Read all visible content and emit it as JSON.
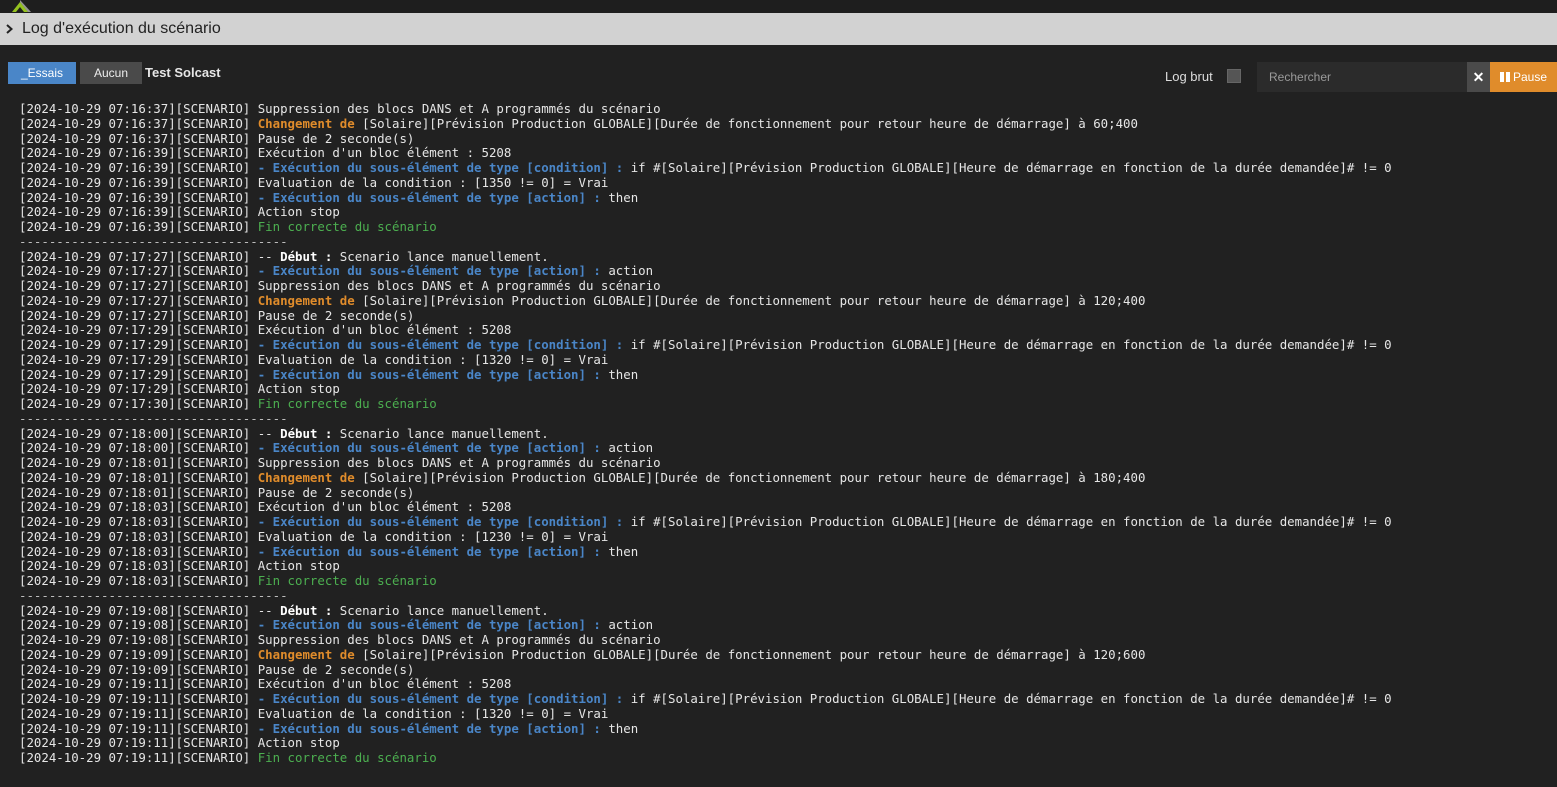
{
  "window": {
    "title": "Log d'exécution du scénario"
  },
  "toolbar": {
    "essais_label": "_Essais",
    "aucun_label": "Aucun",
    "scenario_name": "Test Solcast",
    "log_brut_label": "Log brut",
    "search_placeholder": "Rechercher",
    "clear_label": "✕",
    "pause_label": "Pause"
  },
  "colors": {
    "accent_blue": "#4a86c8",
    "accent_orange": "#e08c2b",
    "success_green": "#4caf50",
    "background": "#212121"
  },
  "log_lines": [
    {
      "type": "entry",
      "prefix": "[2024-10-29 07:16:37][SCENARIO] ",
      "parts": [
        {
          "s": "plain",
          "t": "Suppression des blocs DANS et A programmés du scénario"
        }
      ]
    },
    {
      "type": "entry",
      "prefix": "[2024-10-29 07:16:37][SCENARIO] ",
      "parts": [
        {
          "s": "orange",
          "t": "Changement de"
        },
        {
          "s": "plain",
          "t": " [Solaire][Prévision Production GLOBALE][Durée de fonctionnement pour retour heure de démarrage] à 60;400"
        }
      ]
    },
    {
      "type": "entry",
      "prefix": "[2024-10-29 07:16:37][SCENARIO] ",
      "parts": [
        {
          "s": "plain",
          "t": "Pause de 2 seconde(s)"
        }
      ]
    },
    {
      "type": "entry",
      "prefix": "[2024-10-29 07:16:39][SCENARIO] ",
      "parts": [
        {
          "s": "plain",
          "t": "Exécution d'un bloc élément : 5208"
        }
      ]
    },
    {
      "type": "entry",
      "prefix": "[2024-10-29 07:16:39][SCENARIO] ",
      "parts": [
        {
          "s": "blue",
          "t": "- Exécution du sous-élément de type [condition] :"
        },
        {
          "s": "plain",
          "t": " if #[Solaire][Prévision Production GLOBALE][Heure de démarrage en fonction de la durée demandée]# != 0"
        }
      ]
    },
    {
      "type": "entry",
      "prefix": "[2024-10-29 07:16:39][SCENARIO] ",
      "parts": [
        {
          "s": "plain",
          "t": "Evaluation de la condition : [1350 != 0] = Vrai"
        }
      ]
    },
    {
      "type": "entry",
      "prefix": "[2024-10-29 07:16:39][SCENARIO] ",
      "parts": [
        {
          "s": "blue",
          "t": "- Exécution du sous-élément de type [action] :"
        },
        {
          "s": "plain",
          "t": " then"
        }
      ]
    },
    {
      "type": "entry",
      "prefix": "[2024-10-29 07:16:39][SCENARIO] ",
      "parts": [
        {
          "s": "plain",
          "t": "Action stop"
        }
      ]
    },
    {
      "type": "entry",
      "prefix": "[2024-10-29 07:16:39][SCENARIO] ",
      "parts": [
        {
          "s": "green",
          "t": "Fin correcte du scénario"
        }
      ]
    },
    {
      "type": "separator",
      "text": "------------------------------------"
    },
    {
      "type": "entry",
      "prefix": "[2024-10-29 07:17:27][SCENARIO] ",
      "parts": [
        {
          "s": "plain",
          "t": "-- "
        },
        {
          "s": "bold",
          "t": "Début :"
        },
        {
          "s": "plain",
          "t": " Scenario lance manuellement."
        }
      ]
    },
    {
      "type": "entry",
      "prefix": "[2024-10-29 07:17:27][SCENARIO] ",
      "parts": [
        {
          "s": "blue",
          "t": "- Exécution du sous-élément de type [action] :"
        },
        {
          "s": "plain",
          "t": " action"
        }
      ]
    },
    {
      "type": "entry",
      "prefix": "[2024-10-29 07:17:27][SCENARIO] ",
      "parts": [
        {
          "s": "plain",
          "t": "Suppression des blocs DANS et A programmés du scénario"
        }
      ]
    },
    {
      "type": "entry",
      "prefix": "[2024-10-29 07:17:27][SCENARIO] ",
      "parts": [
        {
          "s": "orange",
          "t": "Changement de"
        },
        {
          "s": "plain",
          "t": " [Solaire][Prévision Production GLOBALE][Durée de fonctionnement pour retour heure de démarrage] à 120;400"
        }
      ]
    },
    {
      "type": "entry",
      "prefix": "[2024-10-29 07:17:27][SCENARIO] ",
      "parts": [
        {
          "s": "plain",
          "t": "Pause de 2 seconde(s)"
        }
      ]
    },
    {
      "type": "entry",
      "prefix": "[2024-10-29 07:17:29][SCENARIO] ",
      "parts": [
        {
          "s": "plain",
          "t": "Exécution d'un bloc élément : 5208"
        }
      ]
    },
    {
      "type": "entry",
      "prefix": "[2024-10-29 07:17:29][SCENARIO] ",
      "parts": [
        {
          "s": "blue",
          "t": "- Exécution du sous-élément de type [condition] :"
        },
        {
          "s": "plain",
          "t": " if #[Solaire][Prévision Production GLOBALE][Heure de démarrage en fonction de la durée demandée]# != 0"
        }
      ]
    },
    {
      "type": "entry",
      "prefix": "[2024-10-29 07:17:29][SCENARIO] ",
      "parts": [
        {
          "s": "plain",
          "t": "Evaluation de la condition : [1320 != 0] = Vrai"
        }
      ]
    },
    {
      "type": "entry",
      "prefix": "[2024-10-29 07:17:29][SCENARIO] ",
      "parts": [
        {
          "s": "blue",
          "t": "- Exécution du sous-élément de type [action] :"
        },
        {
          "s": "plain",
          "t": " then"
        }
      ]
    },
    {
      "type": "entry",
      "prefix": "[2024-10-29 07:17:29][SCENARIO] ",
      "parts": [
        {
          "s": "plain",
          "t": "Action stop"
        }
      ]
    },
    {
      "type": "entry",
      "prefix": "[2024-10-29 07:17:30][SCENARIO] ",
      "parts": [
        {
          "s": "green",
          "t": "Fin correcte du scénario"
        }
      ]
    },
    {
      "type": "separator",
      "text": "------------------------------------"
    },
    {
      "type": "entry",
      "prefix": "[2024-10-29 07:18:00][SCENARIO] ",
      "parts": [
        {
          "s": "plain",
          "t": "-- "
        },
        {
          "s": "bold",
          "t": "Début :"
        },
        {
          "s": "plain",
          "t": " Scenario lance manuellement."
        }
      ]
    },
    {
      "type": "entry",
      "prefix": "[2024-10-29 07:18:00][SCENARIO] ",
      "parts": [
        {
          "s": "blue",
          "t": "- Exécution du sous-élément de type [action] :"
        },
        {
          "s": "plain",
          "t": " action"
        }
      ]
    },
    {
      "type": "entry",
      "prefix": "[2024-10-29 07:18:01][SCENARIO] ",
      "parts": [
        {
          "s": "plain",
          "t": "Suppression des blocs DANS et A programmés du scénario"
        }
      ]
    },
    {
      "type": "entry",
      "prefix": "[2024-10-29 07:18:01][SCENARIO] ",
      "parts": [
        {
          "s": "orange",
          "t": "Changement de"
        },
        {
          "s": "plain",
          "t": " [Solaire][Prévision Production GLOBALE][Durée de fonctionnement pour retour heure de démarrage] à 180;400"
        }
      ]
    },
    {
      "type": "entry",
      "prefix": "[2024-10-29 07:18:01][SCENARIO] ",
      "parts": [
        {
          "s": "plain",
          "t": "Pause de 2 seconde(s)"
        }
      ]
    },
    {
      "type": "entry",
      "prefix": "[2024-10-29 07:18:03][SCENARIO] ",
      "parts": [
        {
          "s": "plain",
          "t": "Exécution d'un bloc élément : 5208"
        }
      ]
    },
    {
      "type": "entry",
      "prefix": "[2024-10-29 07:18:03][SCENARIO] ",
      "parts": [
        {
          "s": "blue",
          "t": "- Exécution du sous-élément de type [condition] :"
        },
        {
          "s": "plain",
          "t": " if #[Solaire][Prévision Production GLOBALE][Heure de démarrage en fonction de la durée demandée]# != 0"
        }
      ]
    },
    {
      "type": "entry",
      "prefix": "[2024-10-29 07:18:03][SCENARIO] ",
      "parts": [
        {
          "s": "plain",
          "t": "Evaluation de la condition : [1230 != 0] = Vrai"
        }
      ]
    },
    {
      "type": "entry",
      "prefix": "[2024-10-29 07:18:03][SCENARIO] ",
      "parts": [
        {
          "s": "blue",
          "t": "- Exécution du sous-élément de type [action] :"
        },
        {
          "s": "plain",
          "t": " then"
        }
      ]
    },
    {
      "type": "entry",
      "prefix": "[2024-10-29 07:18:03][SCENARIO] ",
      "parts": [
        {
          "s": "plain",
          "t": "Action stop"
        }
      ]
    },
    {
      "type": "entry",
      "prefix": "[2024-10-29 07:18:03][SCENARIO] ",
      "parts": [
        {
          "s": "green",
          "t": "Fin correcte du scénario"
        }
      ]
    },
    {
      "type": "separator",
      "text": "------------------------------------"
    },
    {
      "type": "entry",
      "prefix": "[2024-10-29 07:19:08][SCENARIO] ",
      "parts": [
        {
          "s": "plain",
          "t": "-- "
        },
        {
          "s": "bold",
          "t": "Début :"
        },
        {
          "s": "plain",
          "t": " Scenario lance manuellement."
        }
      ]
    },
    {
      "type": "entry",
      "prefix": "[2024-10-29 07:19:08][SCENARIO] ",
      "parts": [
        {
          "s": "blue",
          "t": "- Exécution du sous-élément de type [action] :"
        },
        {
          "s": "plain",
          "t": " action"
        }
      ]
    },
    {
      "type": "entry",
      "prefix": "[2024-10-29 07:19:08][SCENARIO] ",
      "parts": [
        {
          "s": "plain",
          "t": "Suppression des blocs DANS et A programmés du scénario"
        }
      ]
    },
    {
      "type": "entry",
      "prefix": "[2024-10-29 07:19:09][SCENARIO] ",
      "parts": [
        {
          "s": "orange",
          "t": "Changement de"
        },
        {
          "s": "plain",
          "t": " [Solaire][Prévision Production GLOBALE][Durée de fonctionnement pour retour heure de démarrage] à 120;600"
        }
      ]
    },
    {
      "type": "entry",
      "prefix": "[2024-10-29 07:19:09][SCENARIO] ",
      "parts": [
        {
          "s": "plain",
          "t": "Pause de 2 seconde(s)"
        }
      ]
    },
    {
      "type": "entry",
      "prefix": "[2024-10-29 07:19:11][SCENARIO] ",
      "parts": [
        {
          "s": "plain",
          "t": "Exécution d'un bloc élément : 5208"
        }
      ]
    },
    {
      "type": "entry",
      "prefix": "[2024-10-29 07:19:11][SCENARIO] ",
      "parts": [
        {
          "s": "blue",
          "t": "- Exécution du sous-élément de type [condition] :"
        },
        {
          "s": "plain",
          "t": " if #[Solaire][Prévision Production GLOBALE][Heure de démarrage en fonction de la durée demandée]# != 0"
        }
      ]
    },
    {
      "type": "entry",
      "prefix": "[2024-10-29 07:19:11][SCENARIO] ",
      "parts": [
        {
          "s": "plain",
          "t": "Evaluation de la condition : [1320 != 0] = Vrai"
        }
      ]
    },
    {
      "type": "entry",
      "prefix": "[2024-10-29 07:19:11][SCENARIO] ",
      "parts": [
        {
          "s": "blue",
          "t": "- Exécution du sous-élément de type [action] :"
        },
        {
          "s": "plain",
          "t": " then"
        }
      ]
    },
    {
      "type": "entry",
      "prefix": "[2024-10-29 07:19:11][SCENARIO] ",
      "parts": [
        {
          "s": "plain",
          "t": "Action stop"
        }
      ]
    },
    {
      "type": "entry",
      "prefix": "[2024-10-29 07:19:11][SCENARIO] ",
      "parts": [
        {
          "s": "green",
          "t": "Fin correcte du scénario"
        }
      ]
    }
  ]
}
